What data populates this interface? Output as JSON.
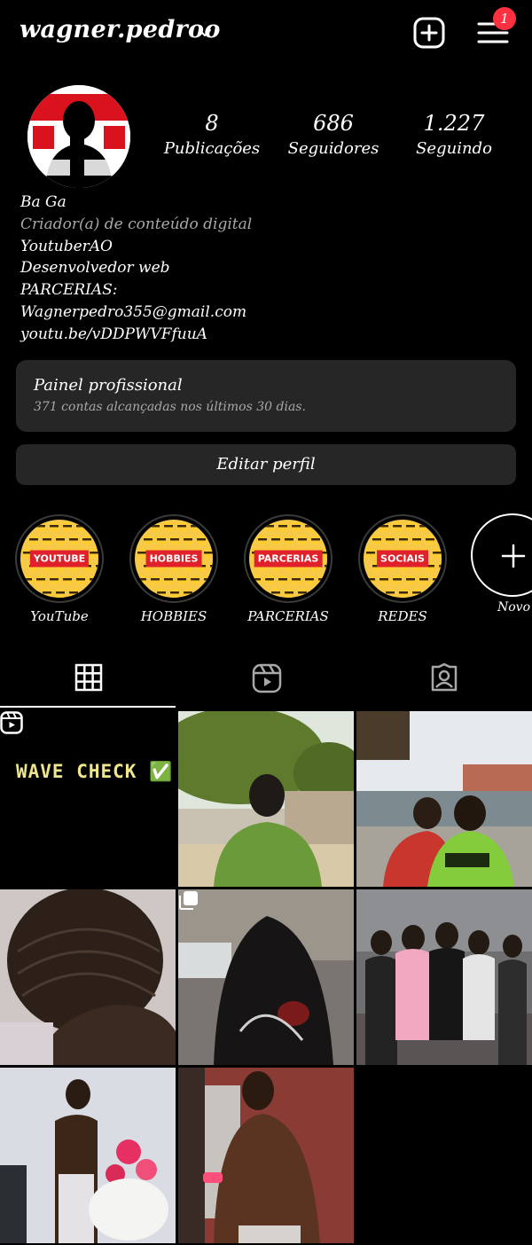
{
  "header": {
    "username": "wagner.pedroo",
    "notification_count": "1",
    "new_post_icon": "plus-square-icon",
    "menu_icon": "hamburger-menu-icon"
  },
  "profile": {
    "posts_count": "8",
    "posts_label": "Publicações",
    "followers_count": "686",
    "followers_label": "Seguidores",
    "following_count": "1.227",
    "following_label": "Seguindo"
  },
  "bio": {
    "name": "Ba Ga",
    "category": "Criador(a) de conteúdo digital",
    "lines": [
      "YoutuberAO",
      "Desenvolvedor web",
      "PARCERIAS:",
      "Wagnerpedro355@gmail.com",
      "youtu.be/vDDPWVFfuuA"
    ]
  },
  "dashboard": {
    "title": "Painel profissional",
    "subtitle": "371 contas alcançadas nos últimos 30 dias."
  },
  "edit_profile_label": "Editar perfil",
  "highlights": [
    {
      "label": "YouTube",
      "tag": "YOUTUBE"
    },
    {
      "label": "HOBBIES",
      "tag": "HOBBIES"
    },
    {
      "label": "PARCERIAS",
      "tag": "PARCERIAS"
    },
    {
      "label": "REDES",
      "tag": "SOCIAIS"
    }
  ],
  "new_highlight_label": "Novo",
  "posts": [
    {
      "caption": "WAVE CHECK ✅",
      "type": "reel"
    },
    {
      "type": "photo"
    },
    {
      "type": "photo"
    },
    {
      "type": "photo"
    },
    {
      "type": "carousel"
    },
    {
      "type": "photo"
    },
    {
      "type": "photo"
    },
    {
      "type": "photo"
    }
  ],
  "colors": {
    "background": "#000000",
    "surface": "#262626",
    "secondary_text": "#a8a8a8",
    "badge": "#ff3040"
  }
}
